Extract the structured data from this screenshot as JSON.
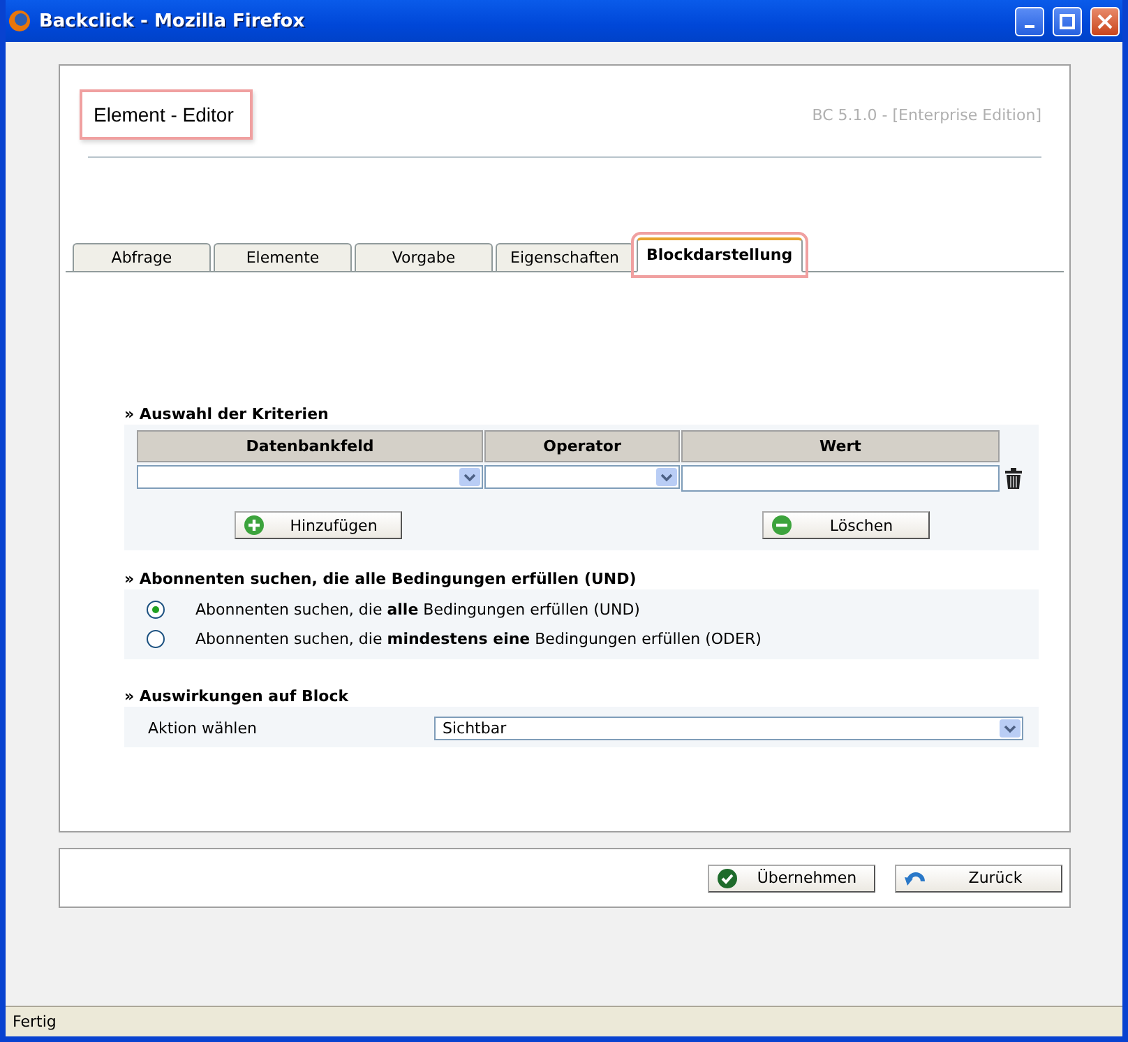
{
  "window": {
    "title": "Backclick - Mozilla Firefox"
  },
  "header": {
    "title": "Element - Editor",
    "version": "BC 5.1.0 - [Enterprise Edition]"
  },
  "tabs": [
    {
      "label": "Abfrage",
      "selected": false
    },
    {
      "label": "Elemente",
      "selected": false
    },
    {
      "label": "Vorgabe",
      "selected": false
    },
    {
      "label": "Eigenschaften",
      "selected": false
    },
    {
      "label": "Blockdarstellung",
      "selected": true
    }
  ],
  "criteria": {
    "heading": "» Auswahl der Kriterien",
    "columns": [
      "Datenbankfeld",
      "Operator",
      "Wert"
    ],
    "buttons": [
      {
        "label": "Hinzufügen",
        "kind": "add"
      },
      {
        "label": "Löschen",
        "kind": "remove"
      }
    ]
  },
  "match": {
    "heading": "» Abonnenten suchen, die alle Bedingungen erfüllen (UND)",
    "options": [
      {
        "label": "Abonnenten suchen, die **alle** Bedingungen erfüllen (UND)",
        "selected": true
      },
      {
        "label": "Abonnenten suchen, die **mindestens eine** Bedingungen erfüllen (ODER)",
        "selected": false
      }
    ]
  },
  "effect": {
    "heading": "» Auswirkungen auf Block",
    "label": "Aktion wählen",
    "value": "Sichtbar"
  },
  "footer_buttons": [
    {
      "label": "Übernehmen",
      "kind": "apply"
    },
    {
      "label": "Zurück",
      "kind": "back"
    }
  ],
  "status_bar": "Fertig"
}
